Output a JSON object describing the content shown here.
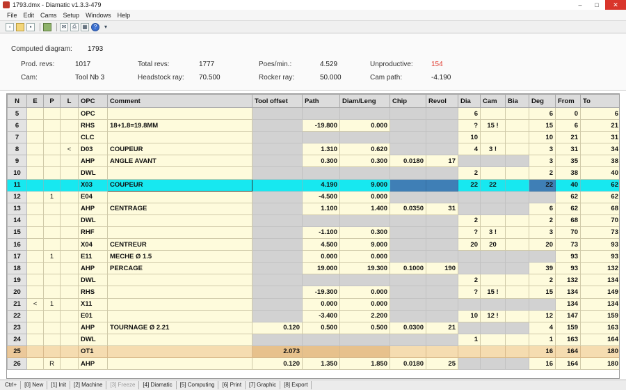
{
  "window": {
    "title": "1793.dmx - Diamatic v1.3.3-479",
    "minimize_glyph": "–",
    "maximize_glyph": "□",
    "close_glyph": "✕"
  },
  "menu": [
    "File",
    "Edit",
    "Cams",
    "Setup",
    "Windows",
    "Help"
  ],
  "toolbar": {
    "icons": [
      "new-file-icon",
      "open-folder-icon",
      "save-icon",
      "copy-icon",
      "mail-icon",
      "print-icon",
      "calculator-icon",
      "help-icon",
      "dropdown-arrow-icon"
    ]
  },
  "info": {
    "computed_label": "Computed diagram:",
    "computed_value": "1793",
    "prod_revs_label": "Prod. revs:",
    "prod_revs_value": "1017",
    "total_revs_label": "Total revs:",
    "total_revs_value": "1777",
    "poses_label": "Poes/min.:",
    "poses_value": "4.529",
    "unproductive_label": "Unproductive:",
    "unproductive_value": "154",
    "cam_label": "Cam:",
    "cam_value": "Tool Nb 3",
    "headstock_label": "Headstock ray:",
    "headstock_value": "70.500",
    "rocker_label": "Rocker ray:",
    "rocker_value": "50.000",
    "campath_label": "Cam path:",
    "campath_value": "-4.190",
    "unproductive_color": "#e03a2e"
  },
  "grid": {
    "columns": [
      "N",
      "E",
      "P",
      "L",
      "OPC",
      "Comment",
      "Tool offset",
      "Path",
      "Diam/Leng",
      "Chip",
      "Revol",
      "Dia",
      "Cam",
      "Bia",
      "Deg",
      "From",
      "To"
    ],
    "rows": [
      {
        "n": "5",
        "e": "",
        "p": "",
        "l": "",
        "opc": "OPC",
        "comment": "",
        "tool": "",
        "path": "",
        "diam": "",
        "chip": "",
        "revol": "",
        "dia": "6",
        "cam": "",
        "bia": "",
        "deg": "6",
        "from": "0",
        "to": "6"
      },
      {
        "n": "6",
        "e": "",
        "p": "",
        "l": "",
        "opc": "RHS",
        "comment": "18+1.8=19.8MM",
        "tool": "",
        "path": "-19.800",
        "diam": "0.000",
        "chip": "",
        "revol": "",
        "dia": "?",
        "cam": "15 !",
        "bia": "",
        "deg": "15",
        "from": "6",
        "to": "21"
      },
      {
        "n": "7",
        "e": "",
        "p": "",
        "l": "",
        "opc": "CLC",
        "comment": "",
        "tool": "",
        "path": "",
        "diam": "",
        "chip": "",
        "revol": "",
        "dia": "10",
        "cam": "",
        "bia": "",
        "deg": "10",
        "from": "21",
        "to": "31"
      },
      {
        "n": "8",
        "e": "",
        "p": "",
        "l": "<",
        "opc": "D03",
        "comment": "COUPEUR",
        "tool": "",
        "path": "1.310",
        "diam": "0.620",
        "chip": "",
        "revol": "",
        "dia": "4",
        "cam": "3 !",
        "bia": "",
        "deg": "3",
        "from": "31",
        "to": "34"
      },
      {
        "n": "9",
        "e": "",
        "p": "",
        "l": "",
        "opc": "AHP",
        "comment": "ANGLE AVANT",
        "tool": "",
        "path": "0.300",
        "diam": "0.300",
        "chip": "0.0180",
        "revol": "17",
        "dia": "",
        "cam": "",
        "bia": "",
        "deg": "3",
        "from": "35",
        "to": "38"
      },
      {
        "n": "10",
        "e": "",
        "p": "",
        "l": "",
        "opc": "DWL",
        "comment": "",
        "tool": "",
        "path": "",
        "diam": "",
        "chip": "",
        "revol": "",
        "dia": "2",
        "cam": "",
        "bia": "",
        "deg": "2",
        "from": "38",
        "to": "40"
      },
      {
        "n": "11",
        "e": "",
        "p": "",
        "l": "",
        "opc": "X03",
        "comment": "COUPEUR",
        "tool": "",
        "path": "4.190",
        "diam": "9.000",
        "chip": "",
        "revol": "",
        "dia": "22",
        "cam": "22",
        "bia": "",
        "deg": "22",
        "from": "40",
        "to": "62"
      },
      {
        "n": "12",
        "e": "",
        "p": "1",
        "l": "",
        "opc": "E04",
        "comment": "",
        "tool": "",
        "path": "-4.500",
        "diam": "0.000",
        "chip": "",
        "revol": "",
        "dia": "",
        "cam": "",
        "bia": "",
        "deg": "",
        "from": "62",
        "to": "62"
      },
      {
        "n": "13",
        "e": "",
        "p": "",
        "l": "",
        "opc": "AHP",
        "comment": "CENTRAGE",
        "tool": "",
        "path": "1.100",
        "diam": "1.400",
        "chip": "0.0350",
        "revol": "31",
        "dia": "",
        "cam": "",
        "bia": "",
        "deg": "6",
        "from": "62",
        "to": "68"
      },
      {
        "n": "14",
        "e": "",
        "p": "",
        "l": "",
        "opc": "DWL",
        "comment": "",
        "tool": "",
        "path": "",
        "diam": "",
        "chip": "",
        "revol": "",
        "dia": "2",
        "cam": "",
        "bia": "",
        "deg": "2",
        "from": "68",
        "to": "70"
      },
      {
        "n": "15",
        "e": "",
        "p": "",
        "l": "",
        "opc": "RHF",
        "comment": "",
        "tool": "",
        "path": "-1.100",
        "diam": "0.300",
        "chip": "",
        "revol": "",
        "dia": "?",
        "cam": "3 !",
        "bia": "",
        "deg": "3",
        "from": "70",
        "to": "73"
      },
      {
        "n": "16",
        "e": "",
        "p": "",
        "l": "",
        "opc": "X04",
        "comment": "CENTREUR",
        "tool": "",
        "path": "4.500",
        "diam": "9.000",
        "chip": "",
        "revol": "",
        "dia": "20",
        "cam": "20",
        "bia": "",
        "deg": "20",
        "from": "73",
        "to": "93"
      },
      {
        "n": "17",
        "e": "",
        "p": "1",
        "l": "",
        "opc": "E11",
        "comment": "MECHE Ø 1.5",
        "tool": "",
        "path": "0.000",
        "diam": "0.000",
        "chip": "",
        "revol": "",
        "dia": "",
        "cam": "",
        "bia": "",
        "deg": "",
        "from": "93",
        "to": "93"
      },
      {
        "n": "18",
        "e": "",
        "p": "",
        "l": "",
        "opc": "AHP",
        "comment": "PERCAGE",
        "tool": "",
        "path": "19.000",
        "diam": "19.300",
        "chip": "0.1000",
        "revol": "190",
        "dia": "",
        "cam": "",
        "bia": "",
        "deg": "39",
        "from": "93",
        "to": "132"
      },
      {
        "n": "19",
        "e": "",
        "p": "",
        "l": "",
        "opc": "DWL",
        "comment": "",
        "tool": "",
        "path": "",
        "diam": "",
        "chip": "",
        "revol": "",
        "dia": "2",
        "cam": "",
        "bia": "",
        "deg": "2",
        "from": "132",
        "to": "134"
      },
      {
        "n": "20",
        "e": "",
        "p": "",
        "l": "",
        "opc": "RHS",
        "comment": "",
        "tool": "",
        "path": "-19.300",
        "diam": "0.000",
        "chip": "",
        "revol": "",
        "dia": "?",
        "cam": "15 !",
        "bia": "",
        "deg": "15",
        "from": "134",
        "to": "149"
      },
      {
        "n": "21",
        "e": "<",
        "p": "1",
        "l": "",
        "opc": "X11",
        "comment": "",
        "tool": "",
        "path": "0.000",
        "diam": "0.000",
        "chip": "",
        "revol": "",
        "dia": "",
        "cam": "",
        "bia": "",
        "deg": "",
        "from": "134",
        "to": "134"
      },
      {
        "n": "22",
        "e": "",
        "p": "",
        "l": "",
        "opc": "E01",
        "comment": "",
        "tool": "",
        "path": "-3.400",
        "diam": "2.200",
        "chip": "",
        "revol": "",
        "dia": "10",
        "cam": "12 !",
        "bia": "",
        "deg": "12",
        "from": "147",
        "to": "159"
      },
      {
        "n": "23",
        "e": "",
        "p": "",
        "l": "",
        "opc": "AHP",
        "comment": "TOURNAGE Ø 2.21",
        "tool": "0.120",
        "path": "0.500",
        "diam": "0.500",
        "chip": "0.0300",
        "revol": "21",
        "dia": "",
        "cam": "",
        "bia": "",
        "deg": "4",
        "from": "159",
        "to": "163"
      },
      {
        "n": "24",
        "e": "",
        "p": "",
        "l": "",
        "opc": "DWL",
        "comment": "",
        "tool": "",
        "path": "",
        "diam": "",
        "chip": "",
        "revol": "",
        "dia": "1",
        "cam": "",
        "bia": "",
        "deg": "1",
        "from": "163",
        "to": "164"
      },
      {
        "n": "25",
        "e": "",
        "p": "",
        "l": "",
        "opc": "OT1",
        "comment": "",
        "tool": "2.073",
        "path": "",
        "diam": "",
        "chip": "",
        "revol": "",
        "dia": "",
        "cam": "",
        "bia": "",
        "deg": "16",
        "from": "164",
        "to": "180"
      },
      {
        "n": "26",
        "e": "",
        "p": "R",
        "l": "",
        "opc": "AHP",
        "comment": "",
        "tool": "0.120",
        "path": "1.350",
        "diam": "1.850",
        "chip": "0.0180",
        "revol": "25",
        "dia": "",
        "cam": "",
        "bia": "",
        "deg": "16",
        "from": "164",
        "to": "180"
      }
    ]
  },
  "statusbar": [
    {
      "label": "Ctrl+",
      "enabled": true
    },
    {
      "label": "[0] New",
      "enabled": true
    },
    {
      "label": "[1] Init",
      "enabled": true
    },
    {
      "label": "[2] Machine",
      "enabled": true
    },
    {
      "label": "[3] Freeze",
      "enabled": false
    },
    {
      "label": "[4] Diamatic",
      "enabled": true
    },
    {
      "label": "[5] Computing",
      "enabled": true
    },
    {
      "label": "[6] Print",
      "enabled": true
    },
    {
      "label": "[7] Graphic",
      "enabled": true
    },
    {
      "label": "[8] Export",
      "enabled": true
    }
  ]
}
